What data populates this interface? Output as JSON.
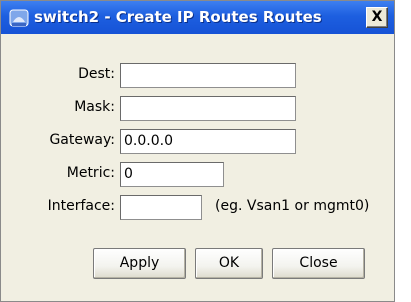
{
  "window": {
    "title": "switch2 - Create IP Routes Routes",
    "close_label": "X",
    "icon": "app-icon"
  },
  "form": {
    "dest": {
      "label": "Dest:",
      "value": ""
    },
    "mask": {
      "label": "Mask:",
      "value": ""
    },
    "gateway": {
      "label": "Gateway:",
      "value": "0.0.0.0"
    },
    "metric": {
      "label": "Metric:",
      "value": "0"
    },
    "interface": {
      "label": "Interface:",
      "value": "",
      "hint": "(eg. Vsan1 or mgmt0)"
    }
  },
  "buttons": {
    "apply": "Apply",
    "ok": "OK",
    "close": "Close"
  },
  "figure_id": "185067",
  "colors": {
    "titlebar": "#1d5fe0",
    "dialog_bg": "#f1efe2"
  }
}
